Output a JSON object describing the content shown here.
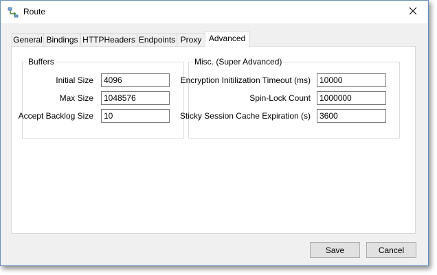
{
  "window": {
    "title": "Route",
    "icon": "route-app-icon",
    "close_icon": "close-icon"
  },
  "tabs": [
    {
      "label": "General",
      "active": false
    },
    {
      "label": "Bindings",
      "active": false
    },
    {
      "label": "HTTPHeaders",
      "active": false
    },
    {
      "label": "Endpoints",
      "active": false
    },
    {
      "label": "Proxy",
      "active": false
    },
    {
      "label": "Advanced",
      "active": true
    }
  ],
  "buffers": {
    "legend": "Buffers",
    "fields": [
      {
        "label": "Initial Size",
        "value": "4096"
      },
      {
        "label": "Max Size",
        "value": "1048576"
      },
      {
        "label": "Accept Backlog Size",
        "value": "10"
      }
    ]
  },
  "misc": {
    "legend": "Misc. (Super Advanced)",
    "fields": [
      {
        "label": "Encryption Initilization Timeout (ms)",
        "value": "10000"
      },
      {
        "label": "Spin-Lock Count",
        "value": "1000000"
      },
      {
        "label": "Sticky Session Cache Expiration (s)",
        "value": "3600"
      }
    ]
  },
  "buttons": {
    "save": "Save",
    "cancel": "Cancel"
  }
}
